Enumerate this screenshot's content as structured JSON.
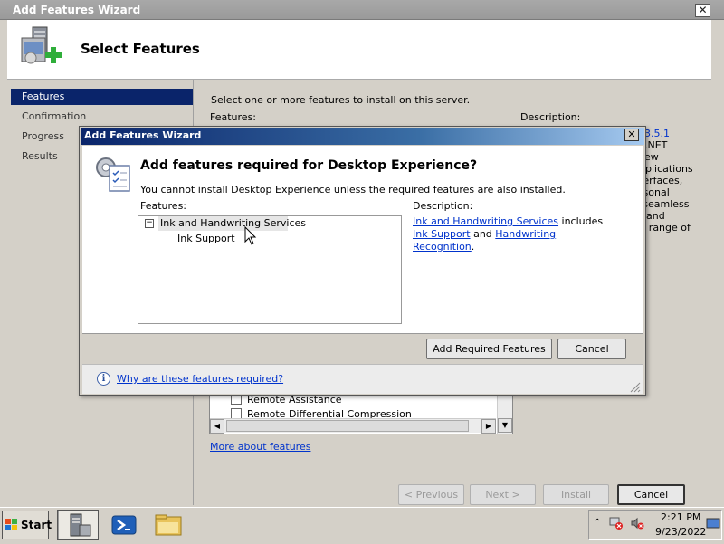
{
  "outer_wizard": {
    "title": "Add Features Wizard",
    "close_glyph": "✕",
    "page_title": "Select Features",
    "nav": [
      {
        "label": "Features",
        "active": true
      },
      {
        "label": "Confirmation",
        "active": false
      },
      {
        "label": "Progress",
        "active": false
      },
      {
        "label": "Results",
        "active": false
      }
    ],
    "instruction": "Select one or more features to install on this server.",
    "features_label": "Features:",
    "description_label": "Description:",
    "description_partial": [
      "3.5.1",
      ".NET",
      "ew",
      "pplications",
      "terfaces,",
      "rsonal",
      "e seamless",
      "and",
      "l a range of"
    ],
    "feature_list": [
      {
        "label": "Remote Assistance",
        "checked": false
      },
      {
        "label": "Remote Differential Compression",
        "checked": false
      }
    ],
    "more_link": "More about features",
    "buttons": {
      "previous": "< Previous",
      "next": "Next >",
      "install": "Install",
      "cancel": "Cancel"
    }
  },
  "modal": {
    "title": "Add Features Wizard",
    "close_glyph": "✕",
    "heading": "Add features required for Desktop Experience?",
    "message": "You cannot install Desktop Experience unless the required features are also installed.",
    "features_label": "Features:",
    "description_label": "Description:",
    "required_features": [
      {
        "label": "Ink and Handwriting Services",
        "level": 0,
        "expanded": true
      },
      {
        "label": "Ink Support",
        "level": 1
      }
    ],
    "description": {
      "link1": "Ink and Handwriting Services",
      "text1": " includes ",
      "link2": "Ink Support",
      "text2": " and ",
      "link3": "Handwriting Recognition",
      "text3": "."
    },
    "buttons": {
      "add": "Add Required Features",
      "cancel": "Cancel"
    },
    "why_link": "Why are these features required?",
    "info_glyph": "i"
  },
  "taskbar": {
    "start_label": "Start",
    "clock_time": "2:21 PM",
    "clock_date": "9/23/2022",
    "tray_arrow": "⌃"
  },
  "colors": {
    "selection": "#0a246a",
    "link": "#0033cc",
    "modal_title_gradient_start": "#0a246a",
    "modal_title_gradient_end": "#a6caf0"
  }
}
